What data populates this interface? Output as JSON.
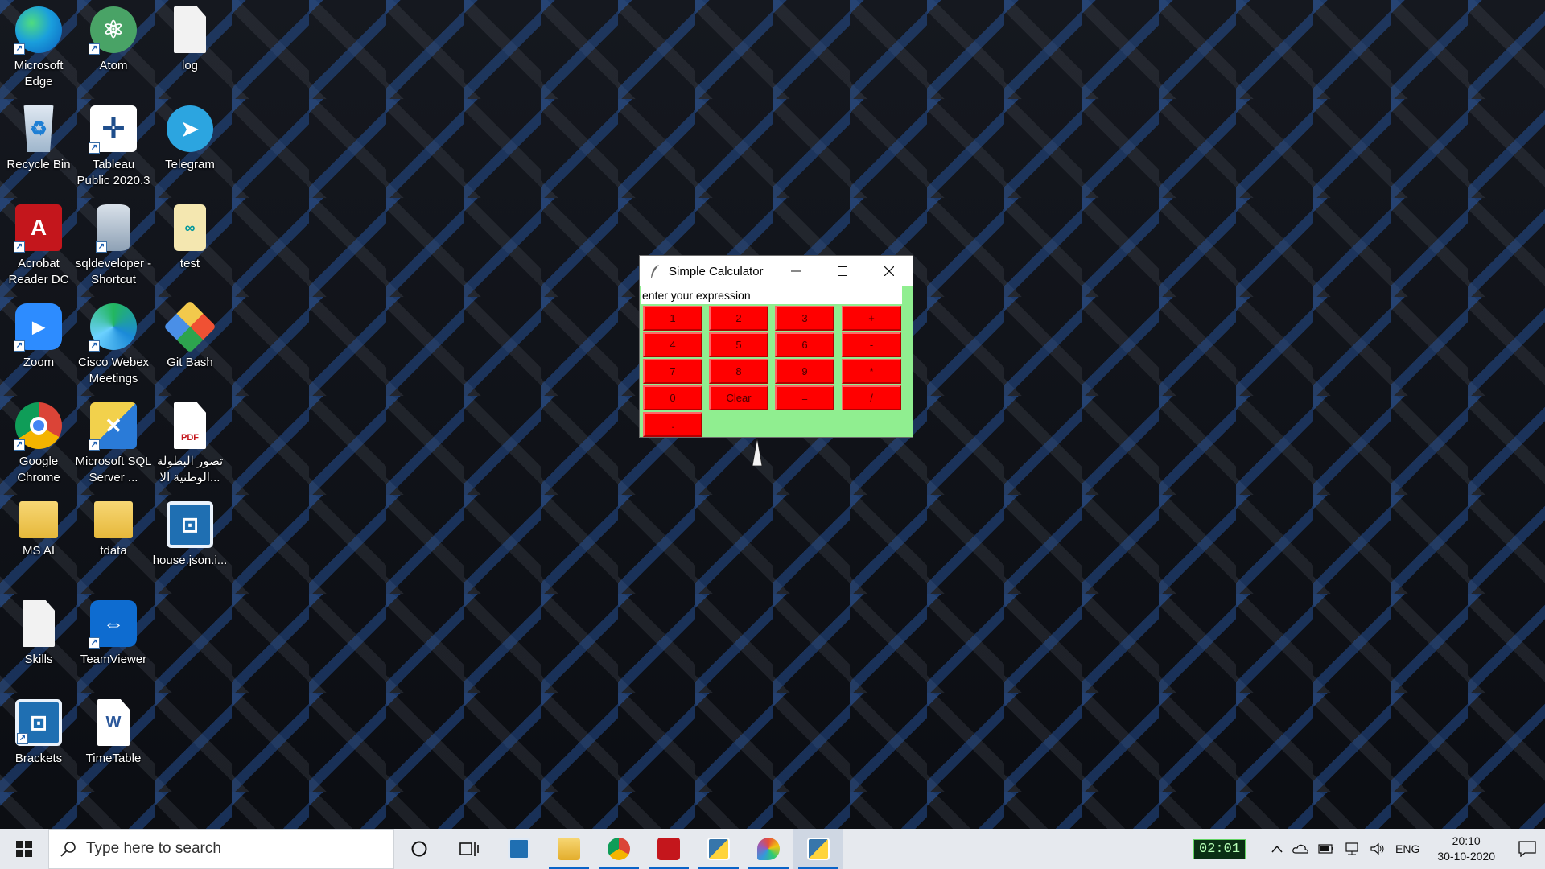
{
  "desktop": {
    "icons": [
      {
        "label": "Microsoft Edge",
        "icon": "edge-icon"
      },
      {
        "label": "Atom",
        "icon": "atom-icon"
      },
      {
        "label": "log",
        "icon": "text-file-icon"
      },
      {
        "label": "Recycle Bin",
        "icon": "recycle-bin-icon"
      },
      {
        "label": "Tableau Public 2020.3",
        "icon": "tableau-icon"
      },
      {
        "label": "Telegram",
        "icon": "telegram-icon"
      },
      {
        "label": "Acrobat Reader DC",
        "icon": "acrobat-icon"
      },
      {
        "label": "sqldeveloper - Shortcut",
        "icon": "sqldeveloper-icon"
      },
      {
        "label": "test",
        "icon": "arduino-file-icon"
      },
      {
        "label": "Zoom",
        "icon": "zoom-icon"
      },
      {
        "label": "Cisco Webex Meetings",
        "icon": "webex-icon"
      },
      {
        "label": "Git Bash",
        "icon": "git-bash-icon"
      },
      {
        "label": "Google Chrome",
        "icon": "chrome-icon"
      },
      {
        "label": "Microsoft SQL Server ...",
        "icon": "sql-server-icon"
      },
      {
        "label": "تصور البطولة الوطنية الا...",
        "icon": "pdf-file-icon"
      },
      {
        "label": "MS AI",
        "icon": "folder-icon"
      },
      {
        "label": "tdata",
        "icon": "folder-icon"
      },
      {
        "label": "house.json.i...",
        "icon": "brackets-file-icon"
      },
      {
        "label": "Skills",
        "icon": "text-file-icon"
      },
      {
        "label": "TeamViewer",
        "icon": "teamviewer-icon"
      },
      {
        "label": "Brackets",
        "icon": "brackets-icon"
      },
      {
        "label": "TimeTable",
        "icon": "word-file-icon"
      }
    ]
  },
  "calculator": {
    "title": "Simple Calculator",
    "expression_value": "enter your expression",
    "buttons": [
      "1",
      "2",
      "3",
      "+",
      "4",
      "5",
      "6",
      "-",
      "7",
      "8",
      "9",
      "*",
      "0",
      "Clear",
      "=",
      "/",
      "."
    ],
    "colors": {
      "button_bg": "#ff0000",
      "window_bg": "#90ee90"
    }
  },
  "taskbar": {
    "search_placeholder": "Type here to search",
    "apps": [
      "brackets-icon",
      "file-explorer-icon",
      "chrome-icon",
      "acrobat-icon",
      "python-idle-icon",
      "paint-icon",
      "python-tk-icon"
    ],
    "tray": {
      "timer": "02:01",
      "language": "ENG",
      "time": "20:10",
      "date": "30-10-2020"
    }
  }
}
